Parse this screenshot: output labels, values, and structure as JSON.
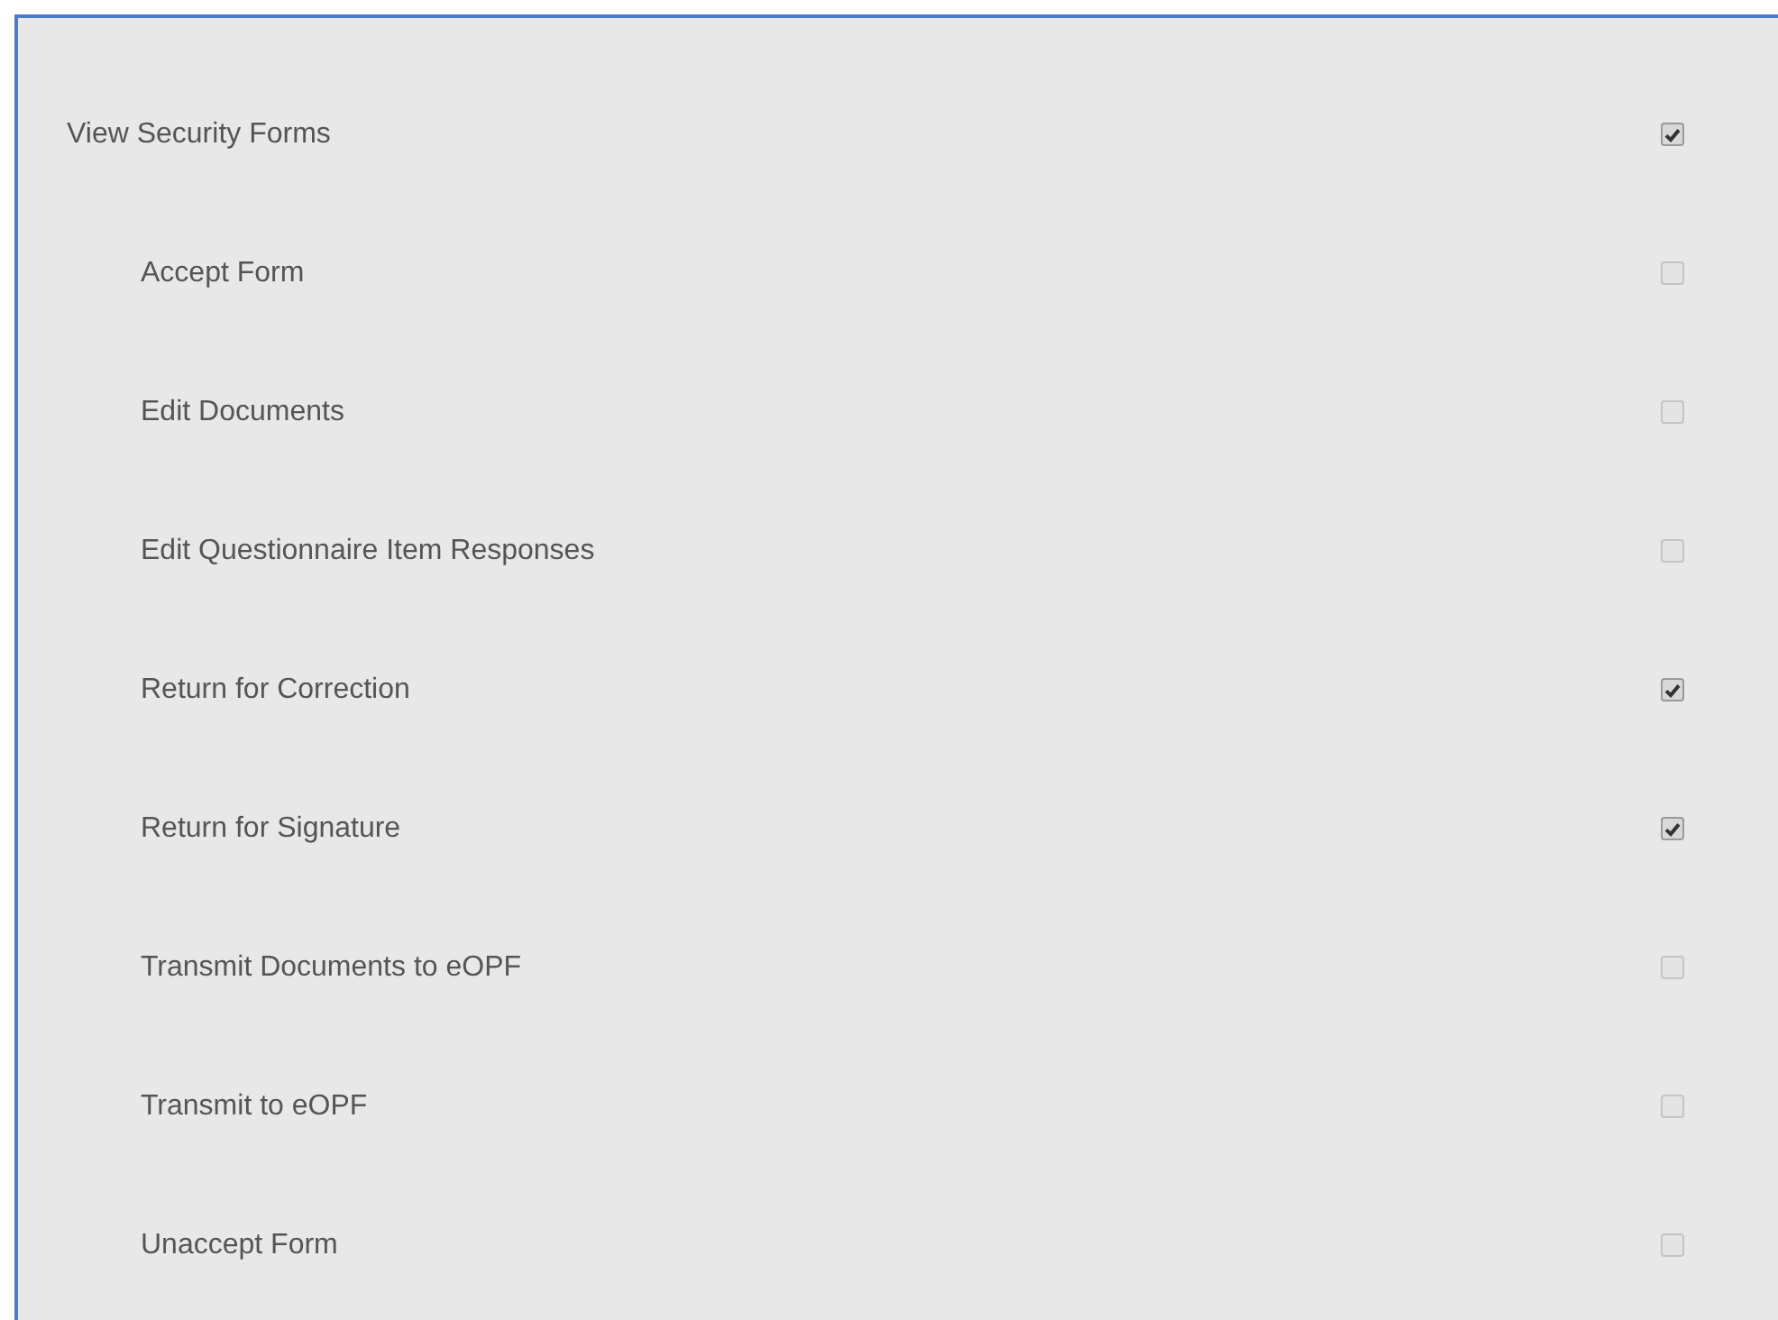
{
  "permissions": [
    {
      "label": "View Security Forms",
      "checked": true,
      "children": [
        {
          "label": "Accept Form",
          "checked": false
        },
        {
          "label": "Edit Documents",
          "checked": false
        },
        {
          "label": "Edit Questionnaire Item Responses",
          "checked": false
        },
        {
          "label": "Return for Correction",
          "checked": true
        },
        {
          "label": "Return for Signature",
          "checked": true
        },
        {
          "label": "Transmit Documents to eOPF",
          "checked": false
        },
        {
          "label": "Transmit to eOPF",
          "checked": false
        },
        {
          "label": "Unaccept Form",
          "checked": false
        }
      ]
    }
  ]
}
